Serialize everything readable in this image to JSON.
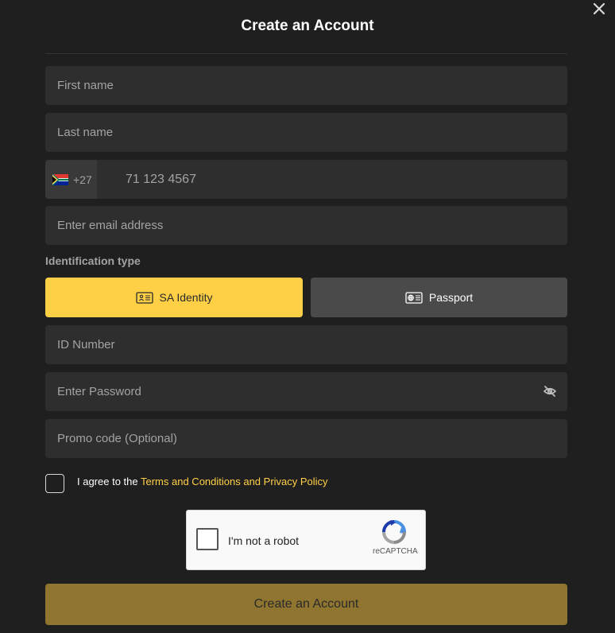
{
  "modal": {
    "title": "Create an Account"
  },
  "form": {
    "first_name": {
      "placeholder": "First name"
    },
    "last_name": {
      "placeholder": "Last name"
    },
    "phone": {
      "dial_code": "+27",
      "country_flag": "south-africa-flag-icon",
      "placeholder": "71 123 4567"
    },
    "email": {
      "placeholder": "Enter email address"
    },
    "identification": {
      "label": "Identification type",
      "options": [
        {
          "label": "SA Identity",
          "icon": "id-card-icon",
          "selected": true
        },
        {
          "label": "Passport",
          "icon": "passport-icon",
          "selected": false
        }
      ]
    },
    "id_number": {
      "placeholder": "ID Number"
    },
    "password": {
      "placeholder": "Enter Password",
      "toggle_icon": "eye-off-icon"
    },
    "promo": {
      "placeholder": "Promo code (Optional)"
    },
    "agree": {
      "prefix": "I agree to the ",
      "link": "Terms and Conditions and Privacy Policy",
      "checked": false
    },
    "recaptcha": {
      "label": "I'm not a robot",
      "brand": "reCAPTCHA"
    },
    "submit_label": "Create an Account"
  },
  "colors": {
    "background": "#1f1f1f",
    "field": "#2e2e2e",
    "accent": "#ffd046",
    "submit_disabled": "#8f7530",
    "muted_text": "#a3a3a3"
  }
}
